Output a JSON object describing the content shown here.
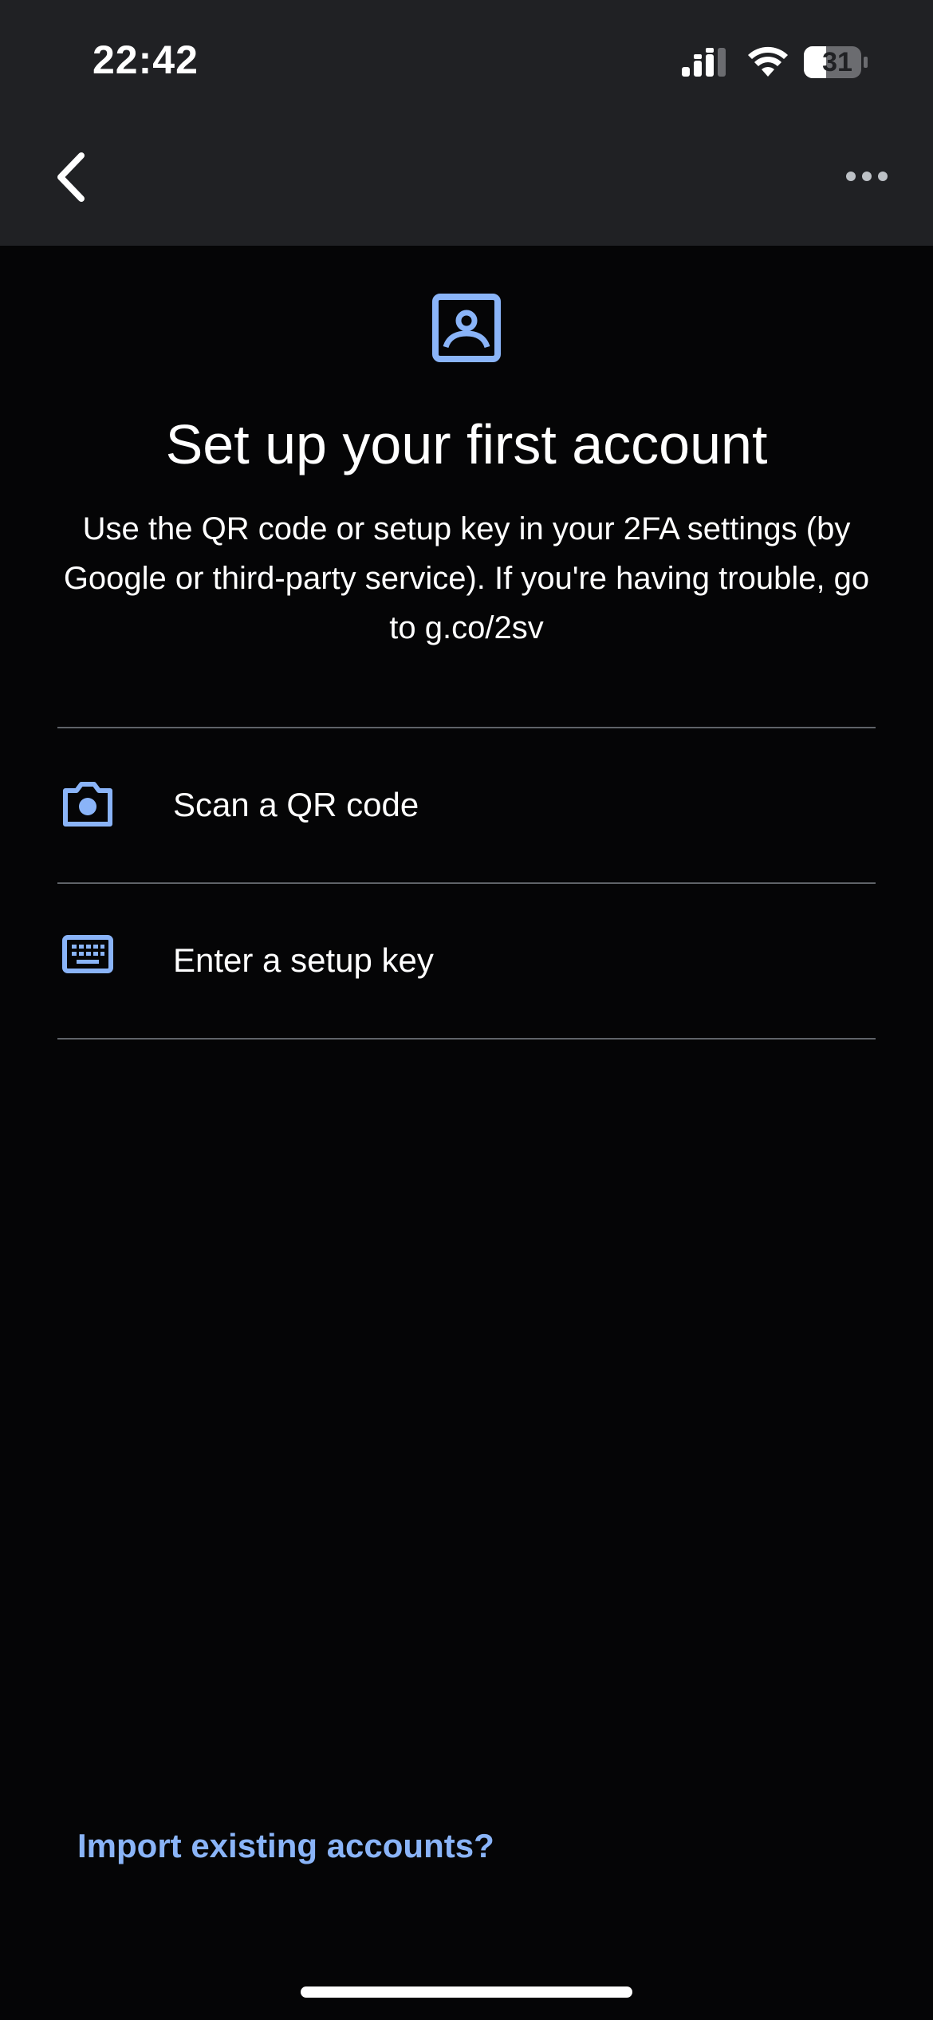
{
  "status_bar": {
    "time": "22:42",
    "battery": "31",
    "icons": [
      "signal-icon",
      "wifi-icon",
      "battery-icon"
    ]
  },
  "header": {
    "back_icon": "chevron-left-icon",
    "more_icon": "more-horizontal-icon"
  },
  "main": {
    "hero_icon": "account-box-icon",
    "title": "Set up your first account",
    "description": "Use the QR code or setup key in your 2FA settings (by Google or third-party service). If you're having trouble, go to g.co/2sv",
    "options": [
      {
        "icon": "camera-icon",
        "label": "Scan a QR code"
      },
      {
        "icon": "keyboard-icon",
        "label": "Enter a setup key"
      }
    ]
  },
  "footer": {
    "import_link": "Import existing accounts?"
  },
  "colors": {
    "accent": "#8ab4f8",
    "header_bg": "#202124",
    "page_bg": "#050506",
    "divider": "#5f6368"
  }
}
